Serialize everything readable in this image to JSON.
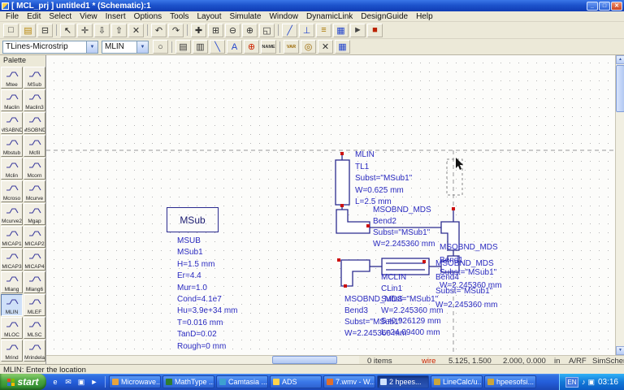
{
  "window": {
    "title": "[ MCL_prj ] untitled1 * (Schematic):1"
  },
  "menu": {
    "items": [
      "File",
      "Edit",
      "Select",
      "View",
      "Insert",
      "Options",
      "Tools",
      "Layout",
      "Simulate",
      "Window",
      "DynamicLink",
      "DesignGuide",
      "Help"
    ]
  },
  "toolbar1": {
    "icons": [
      {
        "name": "new-design-icon",
        "glyph": "□"
      },
      {
        "name": "open-design-icon",
        "glyph": "▤",
        "color": "#b8860b"
      },
      {
        "name": "print-icon",
        "glyph": "⊟"
      },
      {
        "name": "sep1",
        "sep": true
      },
      {
        "name": "pointer-icon",
        "glyph": "↖",
        "color": "#111"
      },
      {
        "name": "pan-view-icon",
        "glyph": "✛"
      },
      {
        "name": "push-into-hierarchy-icon",
        "glyph": "⇩"
      },
      {
        "name": "pop-out-hierarchy-icon",
        "glyph": "⇧"
      },
      {
        "name": "delete-icon",
        "glyph": "✕"
      },
      {
        "name": "sep2",
        "sep": true
      },
      {
        "name": "undo-icon",
        "glyph": "↶"
      },
      {
        "name": "redo-icon",
        "glyph": "↷"
      },
      {
        "name": "sep3",
        "sep": true
      },
      {
        "name": "move-component-icon",
        "glyph": "✚"
      },
      {
        "name": "zoom-area-icon",
        "glyph": "⊞"
      },
      {
        "name": "zoom-out-icon",
        "glyph": "⊖"
      },
      {
        "name": "zoom-in-icon",
        "glyph": "⊕"
      },
      {
        "name": "view-all-icon",
        "glyph": "◱"
      },
      {
        "name": "sep4",
        "sep": true
      },
      {
        "name": "insert-wire-icon",
        "glyph": "╱",
        "color": "#2244cc"
      },
      {
        "name": "insert-ground-icon",
        "glyph": "⊥",
        "color": "#2244cc"
      },
      {
        "name": "insert-var-equation-icon",
        "glyph": "≡",
        "color": "#aa7700"
      },
      {
        "name": "data-display-icon",
        "glyph": "▦",
        "color": "#2244cc"
      },
      {
        "name": "simulate-icon",
        "glyph": "►",
        "color": "#444"
      },
      {
        "name": "stop-simulation-icon",
        "glyph": "■",
        "color": "#bb2200"
      }
    ]
  },
  "toolbar2": {
    "palette_select": "TLines-Microstrip",
    "component_select": "MLIN",
    "icons": [
      {
        "name": "component-history-icon",
        "glyph": "○"
      },
      {
        "name": "sep1",
        "sep": true
      },
      {
        "name": "display-item-parameters-icon",
        "glyph": "▤"
      },
      {
        "name": "component-library-icon",
        "glyph": "▥"
      },
      {
        "name": "insert-wire-icon",
        "glyph": "╲",
        "color": "#2244cc"
      },
      {
        "name": "wire-label-icon",
        "glyph": "A",
        "color": "#2244cc"
      },
      {
        "name": "goto-reference-icon",
        "glyph": "⊕",
        "color": "#cc2200"
      },
      {
        "name": "name-node-icon",
        "glyph": "NAME"
      },
      {
        "name": "sep2",
        "sep": true
      },
      {
        "name": "var-equation-icon",
        "glyph": "VAR",
        "color": "#996600"
      },
      {
        "name": "measurement-equation-icon",
        "glyph": "◎",
        "color": "#996600"
      },
      {
        "name": "deactivate-component-icon",
        "glyph": "✕"
      },
      {
        "name": "simulation-setup-icon",
        "glyph": "▦",
        "color": "#2244cc"
      }
    ]
  },
  "palette": {
    "title": "Palette",
    "selected": "MLIN",
    "items": [
      "Mtee",
      "MSub",
      "Maclin",
      "Maclin3",
      "MSABND",
      "MSOBND",
      "Mbstub",
      "Mcfil",
      "Mclin",
      "Mcorn",
      "Mcroso",
      "Mcurve",
      "Mcurve2",
      "Mgap",
      "MICAP1",
      "MICAP2",
      "MICAP3",
      "MICAP4",
      "Mlang",
      "Mlang6",
      "MLIN",
      "MLEF",
      "MLOC",
      "MLSC",
      "Mrind",
      "Mrindela"
    ]
  },
  "schematic": {
    "msub_box_label": "MSub",
    "msub": [
      "MSUB",
      "MSub1",
      "H=1.5 mm",
      "Er=4.4",
      "Mur=1.0",
      "Cond=4.1e7",
      "Hu=3.9e+34 mm",
      "T=0.016 mm",
      "TanD=0.02",
      "Rough=0 mm"
    ],
    "tl1": [
      "MLIN",
      "TL1",
      "Subst=\"MSub1\"",
      "W=0.625 mm",
      "L=2.5 mm"
    ],
    "bend2": [
      "MSOBND_MDS",
      "Bend2",
      "Subst=\"MSub1\"",
      "W=2.245360 mm"
    ],
    "bend1": [
      "MSOBND_MDS",
      "Bend1",
      "Subst=\"MSub1\"",
      "W=2.245360 mm"
    ],
    "bend4": [
      "MSOBND_MDS",
      "Bend4",
      "Subst=\"MSub1\"",
      "W=2.245360 mm"
    ],
    "clin1": [
      "MCLIN",
      "CLin1",
      "Subst=\"MSub1\"",
      "W=2.245360 mm",
      "S=0.926129 mm",
      "L=24.09400 mm"
    ],
    "bend3": [
      "MSOBND_MDS",
      "Bend3",
      "Subst=\"MSub1\"",
      "W=2.245360 mm"
    ]
  },
  "statusbar": {
    "message": "MLIN: Enter the location",
    "items": "0 items",
    "net": "wire",
    "cursor_xy": "5.125, 1.500",
    "delta_xy": "2.000, 0.000",
    "units": "in",
    "mode": "A/RF",
    "view": "SimSchem"
  },
  "taskbar": {
    "start_label": "start",
    "quicklaunch": [
      {
        "name": "ie-icon",
        "glyph": "e"
      },
      {
        "name": "outlook-icon",
        "glyph": "✉"
      },
      {
        "name": "show-desktop-icon",
        "glyph": "▣"
      },
      {
        "name": "media-player-icon",
        "glyph": "►"
      }
    ],
    "buttons": [
      {
        "label": "Microwave...",
        "icon_color": "#e8a33d"
      },
      {
        "label": "MathType ...",
        "icon_color": "#2f7d2f"
      },
      {
        "label": "Camtasia ...",
        "icon_color": "#3da0d0"
      },
      {
        "label": "ADS",
        "icon_color": "#ffd24a"
      },
      {
        "label": "7.wmv - W...",
        "icon_color": "#e06f2c"
      },
      {
        "label": "2 hpees...",
        "icon_color": "#cfe2ff",
        "active": true
      },
      {
        "label": "LineCalc/u...",
        "icon_color": "#caa53c"
      },
      {
        "label": "hpeesofsi...",
        "icon_color": "#caa53c"
      }
    ],
    "tray_lang": "EN",
    "tray_icons": [
      {
        "name": "tray-volume-icon",
        "glyph": "♪"
      },
      {
        "name": "tray-network-icon",
        "glyph": "▣"
      }
    ],
    "clock": "03:16"
  },
  "colors": {
    "schematic_text": "#2a2ac0",
    "pin_red": "#cc1111",
    "taskbar_blue": "#245edb"
  }
}
